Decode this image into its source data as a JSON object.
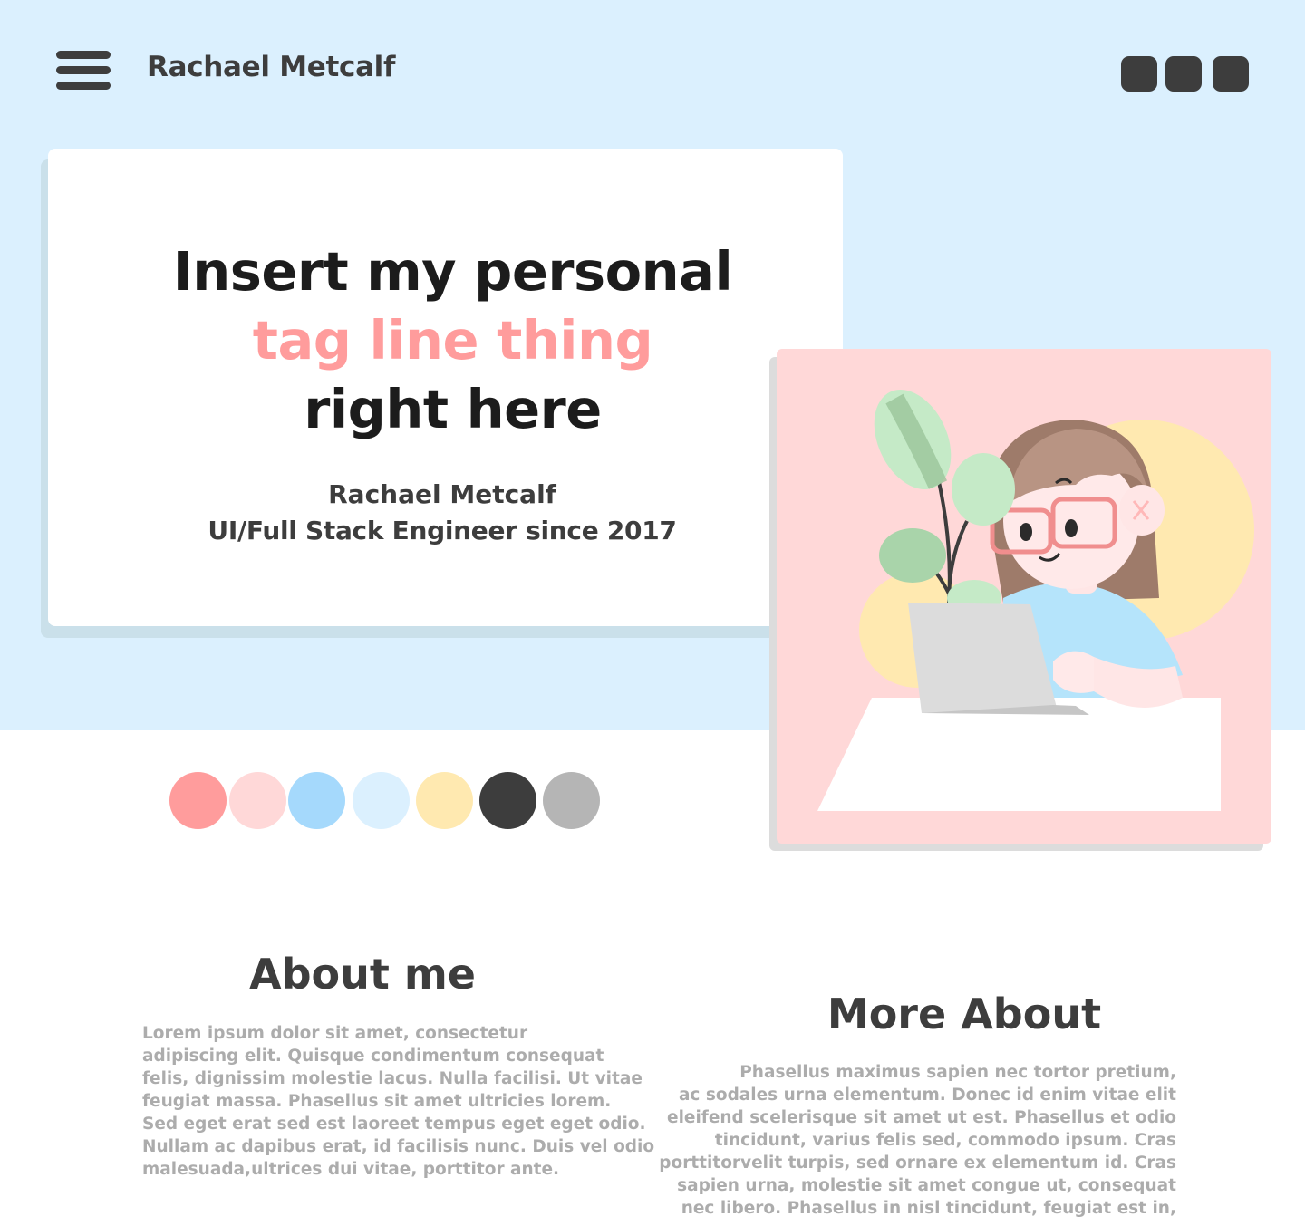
{
  "header": {
    "menu_icon": "hamburger-menu-icon",
    "site_name": "Rachael Metcalf",
    "social_buttons": [
      "social-link-1",
      "social-link-2",
      "social-link-3"
    ]
  },
  "hero": {
    "tagline": {
      "line1": "Insert my personal",
      "line2": "tag line thing",
      "line3": "right here"
    },
    "name": "Rachael Metcalf",
    "role": "UI/Full Stack Engineer since 2017"
  },
  "palette": [
    "#ff9c9c",
    "#ffd8d8",
    "#a5d9fc",
    "#dbf0fe",
    "#ffe9b0",
    "#3d3d3d",
    "#b5b5b5"
  ],
  "about": {
    "title": "About me",
    "lines": [
      "Lorem ipsum dolor sit amet, consectetur",
      "adipiscing elit. Quisque condimentum consequat",
      "felis, dignissim molestie lacus. Nulla facilisi. Ut vitae",
      "feugiat massa. Phasellus sit amet ultricies lorem.",
      "Sed eget erat sed est laoreet tempus eget eget odio.",
      "Nullam ac dapibus erat, id facilisis nunc. Duis vel odio",
      "malesuada,ultrices dui vitae, porttitor ante."
    ]
  },
  "more": {
    "title": "More About",
    "lines": [
      "Phasellus maximus sapien nec tortor pretium,",
      "ac sodales urna elementum. Donec id enim vitae elit",
      "eleifend scelerisque sit amet ut est. Phasellus et odio",
      "tincidunt, varius felis sed, commodo ipsum. Cras",
      "porttitorvelit turpis, sed ornare ex elementum id. Cras",
      "sapien urna, molestie sit amet congue ut, consequat",
      "nec libero. Phasellus in nisl tincidunt, feugiat est in,"
    ]
  },
  "colors": {
    "hero_background": "#dbf0fe",
    "accent": "#ff9c9c",
    "text_dark": "#3d3d3d",
    "text_muted": "#acacac"
  }
}
